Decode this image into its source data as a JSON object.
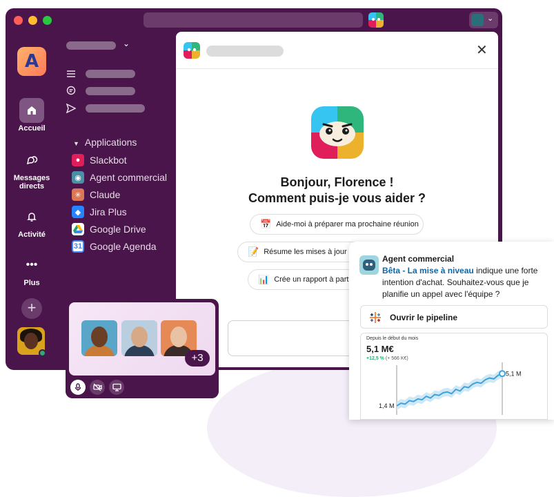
{
  "colors": {
    "aubergine": "#4a154b",
    "accent_link": "#1264a3",
    "positive": "#2bac76",
    "chart_line": "#3ea3d9"
  },
  "rail": {
    "items": [
      {
        "label": "Accueil",
        "icon": "home-icon"
      },
      {
        "label": "Messages\ndirects",
        "icon": "dm-icon"
      },
      {
        "label": "Activité",
        "icon": "bell-icon"
      },
      {
        "label": "Plus",
        "icon": "more-icon"
      }
    ]
  },
  "sidebar": {
    "apps_header": "Applications",
    "apps": [
      {
        "label": "Slackbot",
        "icon": "slackbot-icon",
        "color": "#e01e5a"
      },
      {
        "label": "Agent commercial",
        "icon": "agent-icon",
        "color": "#4a8fa6"
      },
      {
        "label": "Claude",
        "icon": "claude-icon",
        "color": "#d97757"
      },
      {
        "label": "Jira Plus",
        "icon": "jira-icon",
        "color": "#2684ff"
      },
      {
        "label": "Google Drive",
        "icon": "drive-icon",
        "color": "#1fa463"
      },
      {
        "label": "Google Agenda",
        "icon": "calendar-icon",
        "color": "#4285f4"
      }
    ]
  },
  "panel": {
    "greeting_line1": "Bonjour, Florence !",
    "greeting_line2": "Comment puis-je vous aider ?",
    "suggestions": [
      {
        "icon": "calendar-icon",
        "label": "Aide-moi à préparer ma prochaine réunion"
      },
      {
        "icon": "memo-icon",
        "label": "Résume les mises à jour réc"
      },
      {
        "icon": "bar-chart-icon",
        "label": "Crée un rapport à partir"
      }
    ]
  },
  "huddle": {
    "more_count": "+3"
  },
  "agent": {
    "name": "Agent commercial",
    "link": "Bêta - La mise à niveau",
    "message": " indique une forte intention d'achat. Souhaitez-vous que je planifie un appel avec l'équipe ?",
    "pipeline_button": "Ouvrir le pipeline"
  },
  "chart_data": {
    "type": "area",
    "caption": "Depuis le début du mois",
    "value": "5,1 M€",
    "delta": "+12,5 %",
    "delta_abs": "(+ 566 K€)",
    "start_label": "1,4 M",
    "end_label": "5,1 M",
    "y": [
      1.4,
      1.7,
      1.6,
      2.0,
      1.9,
      2.2,
      2.1,
      2.5,
      2.3,
      2.7,
      2.6,
      2.9,
      3.0,
      2.8,
      3.3,
      3.1,
      3.6,
      3.5,
      3.9,
      4.1,
      4.0,
      4.4,
      4.6,
      4.5,
      4.9,
      5.1
    ],
    "ylim": [
      1.0,
      5.6
    ]
  }
}
